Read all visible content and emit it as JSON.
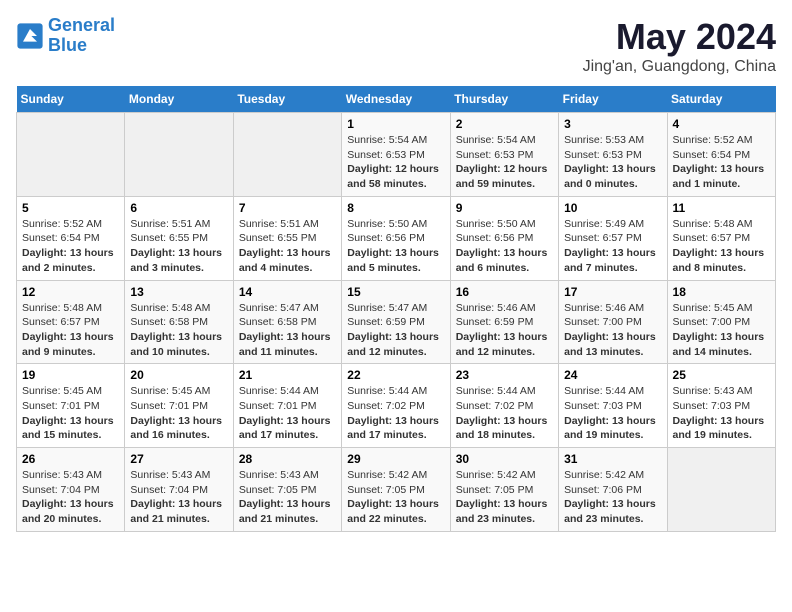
{
  "header": {
    "logo_line1": "General",
    "logo_line2": "Blue",
    "month_year": "May 2024",
    "location": "Jing'an, Guangdong, China"
  },
  "days_of_week": [
    "Sunday",
    "Monday",
    "Tuesday",
    "Wednesday",
    "Thursday",
    "Friday",
    "Saturday"
  ],
  "weeks": [
    [
      {
        "day": "",
        "info": ""
      },
      {
        "day": "",
        "info": ""
      },
      {
        "day": "",
        "info": ""
      },
      {
        "day": "1",
        "info": "Sunrise: 5:54 AM\nSunset: 6:53 PM\nDaylight: 12 hours and 58 minutes."
      },
      {
        "day": "2",
        "info": "Sunrise: 5:54 AM\nSunset: 6:53 PM\nDaylight: 12 hours and 59 minutes."
      },
      {
        "day": "3",
        "info": "Sunrise: 5:53 AM\nSunset: 6:53 PM\nDaylight: 13 hours and 0 minutes."
      },
      {
        "day": "4",
        "info": "Sunrise: 5:52 AM\nSunset: 6:54 PM\nDaylight: 13 hours and 1 minute."
      }
    ],
    [
      {
        "day": "5",
        "info": "Sunrise: 5:52 AM\nSunset: 6:54 PM\nDaylight: 13 hours and 2 minutes."
      },
      {
        "day": "6",
        "info": "Sunrise: 5:51 AM\nSunset: 6:55 PM\nDaylight: 13 hours and 3 minutes."
      },
      {
        "day": "7",
        "info": "Sunrise: 5:51 AM\nSunset: 6:55 PM\nDaylight: 13 hours and 4 minutes."
      },
      {
        "day": "8",
        "info": "Sunrise: 5:50 AM\nSunset: 6:56 PM\nDaylight: 13 hours and 5 minutes."
      },
      {
        "day": "9",
        "info": "Sunrise: 5:50 AM\nSunset: 6:56 PM\nDaylight: 13 hours and 6 minutes."
      },
      {
        "day": "10",
        "info": "Sunrise: 5:49 AM\nSunset: 6:57 PM\nDaylight: 13 hours and 7 minutes."
      },
      {
        "day": "11",
        "info": "Sunrise: 5:48 AM\nSunset: 6:57 PM\nDaylight: 13 hours and 8 minutes."
      }
    ],
    [
      {
        "day": "12",
        "info": "Sunrise: 5:48 AM\nSunset: 6:57 PM\nDaylight: 13 hours and 9 minutes."
      },
      {
        "day": "13",
        "info": "Sunrise: 5:48 AM\nSunset: 6:58 PM\nDaylight: 13 hours and 10 minutes."
      },
      {
        "day": "14",
        "info": "Sunrise: 5:47 AM\nSunset: 6:58 PM\nDaylight: 13 hours and 11 minutes."
      },
      {
        "day": "15",
        "info": "Sunrise: 5:47 AM\nSunset: 6:59 PM\nDaylight: 13 hours and 12 minutes."
      },
      {
        "day": "16",
        "info": "Sunrise: 5:46 AM\nSunset: 6:59 PM\nDaylight: 13 hours and 12 minutes."
      },
      {
        "day": "17",
        "info": "Sunrise: 5:46 AM\nSunset: 7:00 PM\nDaylight: 13 hours and 13 minutes."
      },
      {
        "day": "18",
        "info": "Sunrise: 5:45 AM\nSunset: 7:00 PM\nDaylight: 13 hours and 14 minutes."
      }
    ],
    [
      {
        "day": "19",
        "info": "Sunrise: 5:45 AM\nSunset: 7:01 PM\nDaylight: 13 hours and 15 minutes."
      },
      {
        "day": "20",
        "info": "Sunrise: 5:45 AM\nSunset: 7:01 PM\nDaylight: 13 hours and 16 minutes."
      },
      {
        "day": "21",
        "info": "Sunrise: 5:44 AM\nSunset: 7:01 PM\nDaylight: 13 hours and 17 minutes."
      },
      {
        "day": "22",
        "info": "Sunrise: 5:44 AM\nSunset: 7:02 PM\nDaylight: 13 hours and 17 minutes."
      },
      {
        "day": "23",
        "info": "Sunrise: 5:44 AM\nSunset: 7:02 PM\nDaylight: 13 hours and 18 minutes."
      },
      {
        "day": "24",
        "info": "Sunrise: 5:44 AM\nSunset: 7:03 PM\nDaylight: 13 hours and 19 minutes."
      },
      {
        "day": "25",
        "info": "Sunrise: 5:43 AM\nSunset: 7:03 PM\nDaylight: 13 hours and 19 minutes."
      }
    ],
    [
      {
        "day": "26",
        "info": "Sunrise: 5:43 AM\nSunset: 7:04 PM\nDaylight: 13 hours and 20 minutes."
      },
      {
        "day": "27",
        "info": "Sunrise: 5:43 AM\nSunset: 7:04 PM\nDaylight: 13 hours and 21 minutes."
      },
      {
        "day": "28",
        "info": "Sunrise: 5:43 AM\nSunset: 7:05 PM\nDaylight: 13 hours and 21 minutes."
      },
      {
        "day": "29",
        "info": "Sunrise: 5:42 AM\nSunset: 7:05 PM\nDaylight: 13 hours and 22 minutes."
      },
      {
        "day": "30",
        "info": "Sunrise: 5:42 AM\nSunset: 7:05 PM\nDaylight: 13 hours and 23 minutes."
      },
      {
        "day": "31",
        "info": "Sunrise: 5:42 AM\nSunset: 7:06 PM\nDaylight: 13 hours and 23 minutes."
      },
      {
        "day": "",
        "info": ""
      }
    ]
  ]
}
